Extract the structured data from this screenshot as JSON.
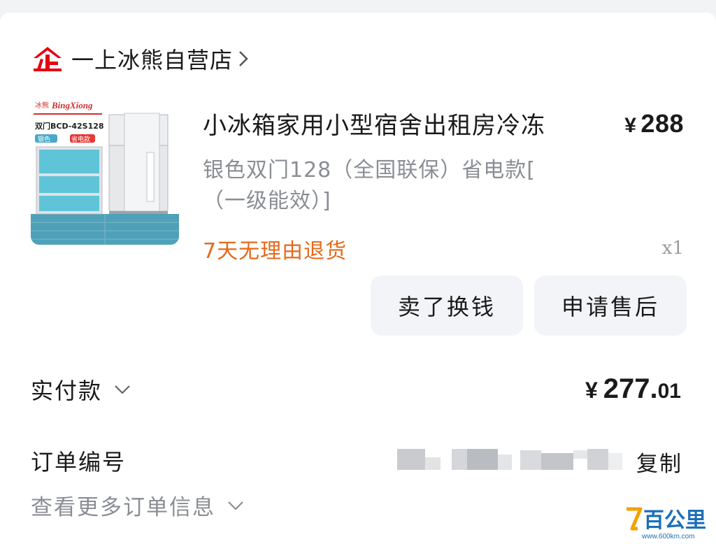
{
  "shop": {
    "name": "一上冰熊自营店",
    "logo_icon": "qi-enterprise-icon",
    "brand_color": "#e60012"
  },
  "product": {
    "title": "小冰箱家用小型宿舍出租房冷冻",
    "price_currency": "¥",
    "price": "288",
    "spec_line1": "银色双门128（全国联保）省电款[",
    "spec_line2": "（一级能效）]",
    "promise": "7天无理由退货",
    "quantity": "x1",
    "thumb": {
      "brand_cn": "冰熊",
      "brand_en": "BingXiong",
      "model": "双门BCD-42S128",
      "color_tag": "银色",
      "energy_tag": "省电款"
    }
  },
  "actions": {
    "sell_label": "卖了换钱",
    "after_sale_label": "申请售后"
  },
  "payment": {
    "label": "实付款",
    "currency": "¥",
    "amount_main": "277.",
    "amount_cents": "01"
  },
  "order": {
    "label": "订单编号",
    "copy_label": "复制",
    "more_label": "查看更多订单信息"
  },
  "watermark": {
    "text": "百公里",
    "url": "www.600km.com"
  },
  "colors": {
    "accent_orange": "#e5691a",
    "muted_text": "#8a8d93",
    "button_bg": "#f3f4f7"
  }
}
